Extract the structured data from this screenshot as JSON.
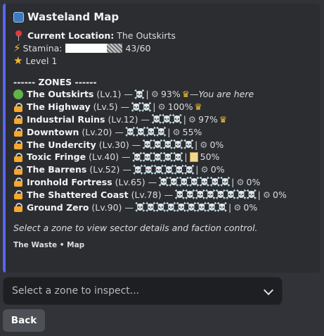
{
  "embed": {
    "title": "Wasteland Map",
    "title_icon": "map-icon",
    "accent_color": "#5865f2",
    "location_label": "Current Location:",
    "location_value": "The Outskirts",
    "stamina_label": "Stamina:",
    "stamina_value": "43/60",
    "stamina_fraction": 0.72,
    "level": "Level 1",
    "zones_header": "------ ZONES ------",
    "zones": [
      {
        "name": "The Outskirts",
        "level": "(Lv.1)",
        "skulls": "☠️",
        "stat": "93%",
        "suffix_icon": "crown",
        "note": "You are here",
        "status": "current"
      },
      {
        "name": "The Highway",
        "level": "(Lv.5)",
        "skulls": "☠️☠️",
        "stat": "100%",
        "suffix_icon": "crown",
        "status": "locked"
      },
      {
        "name": "Industrial Ruins",
        "level": "(Lv.12)",
        "skulls": "☠️☠️☠️",
        "stat": "97%",
        "suffix_icon": "crown",
        "status": "locked"
      },
      {
        "name": "Downtown",
        "level": "(Lv.20)",
        "skulls": "☠️☠️☠️☠️",
        "stat": "55%",
        "status": "locked"
      },
      {
        "name": "The Undercity",
        "level": "(Lv.30)",
        "skulls": "☠️☠️☠️☠️☠️",
        "stat": "0%",
        "status": "locked"
      },
      {
        "name": "Toxic Fringe",
        "level": "(Lv.40)",
        "skulls": "☠️☠️☠️☠️☠️",
        "stat": "50%",
        "stat_icon": "scroll",
        "status": "locked"
      },
      {
        "name": "The Barrens",
        "level": "(Lv.52)",
        "skulls": "☠️☠️☠️☠️☠️☠️",
        "stat": "0%",
        "status": "locked"
      },
      {
        "name": "Ironhold Fortress",
        "level": "(Lv.65)",
        "skulls": "☠️☠️☠️☠️☠️☠️☠️",
        "stat": "0%",
        "status": "locked"
      },
      {
        "name": "The Shattered Coast",
        "level": "(Lv.78)",
        "skulls": "☠️☠️☠️☠️☠️☠️☠️☠️",
        "stat": "0%",
        "status": "locked"
      },
      {
        "name": "Ground Zero",
        "level": "(Lv.90)",
        "skulls": "☠️☠️☠️☠️☠️☠️☠️☠️☠️",
        "stat": "0%",
        "status": "locked"
      }
    ],
    "hint": "Select a zone to view sector details and faction control.",
    "footer": "The Waste • Map"
  },
  "select": {
    "placeholder": "Select a zone to inspect..."
  },
  "buttons": {
    "back": "Back"
  }
}
